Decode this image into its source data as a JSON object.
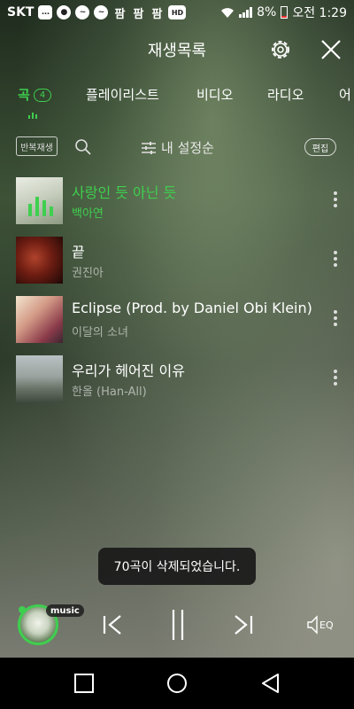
{
  "status_bar": {
    "carrier": "SKT",
    "notif_icons": [
      "chat-icon",
      "app-icon",
      "messenger-icon",
      "messenger-icon",
      "pampampam-icon",
      "pampampam-icon",
      "pampampam-icon",
      "hd-voice-icon"
    ],
    "pam_label": "팜",
    "hd_label": "HD",
    "battery": "8%",
    "time": "오전 1:29"
  },
  "header": {
    "title": "재생목록"
  },
  "tabs": [
    {
      "label": "곡",
      "count": "4",
      "active": true
    },
    {
      "label": "플레이리스트",
      "active": false
    },
    {
      "label": "비디오",
      "active": false
    },
    {
      "label": "라디오",
      "active": false
    },
    {
      "label": "어",
      "active": false
    }
  ],
  "toolbar": {
    "repeat_label": "반복재생",
    "sort_label": "내 설정순",
    "edit_label": "편집"
  },
  "songs": [
    {
      "title": "사랑인 듯 아닌 듯",
      "artist": "백아연",
      "playing": true
    },
    {
      "title": "끝",
      "artist": "권진아",
      "playing": false
    },
    {
      "title": "Eclipse (Prod. by Daniel Obi Klein)",
      "artist": "이달의 소녀",
      "playing": false
    },
    {
      "title": "우리가 헤어진 이유",
      "artist": "한올 (Han-All)",
      "playing": false
    }
  ],
  "toast": {
    "message": "70곡이 삭제되었습니다."
  },
  "player": {
    "badge": "music",
    "eq_label": "EQ"
  },
  "colors": {
    "accent": "#3fcf4f"
  }
}
